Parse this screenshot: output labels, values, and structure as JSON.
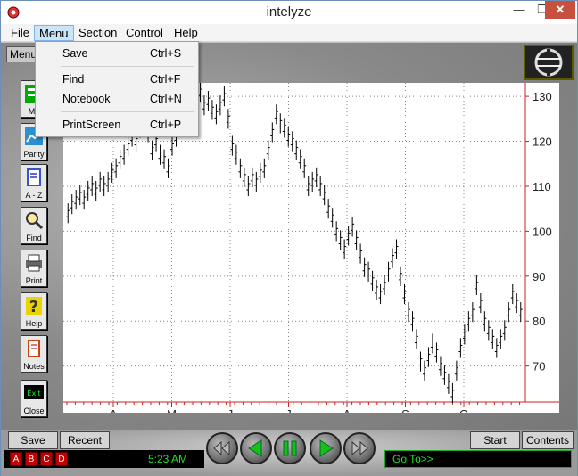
{
  "window": {
    "title": "intelyze"
  },
  "titlebar_buttons": {
    "minimize": "—",
    "maximize": "❐",
    "close": "✕"
  },
  "menubar": [
    {
      "label": "File"
    },
    {
      "label": "Menu"
    },
    {
      "label": "Section"
    },
    {
      "label": "Control"
    },
    {
      "label": "Help"
    }
  ],
  "dropdown": {
    "items": [
      {
        "label": "Save",
        "shortcut": "Ctrl+S"
      },
      {
        "label": "Find",
        "shortcut": "Ctrl+F"
      },
      {
        "label": "Notebook",
        "shortcut": "Ctrl+N"
      },
      {
        "label": "PrintScreen",
        "shortcut": "Ctrl+P"
      }
    ]
  },
  "menu_tab": "Menu",
  "toolbar": [
    {
      "label": "Me",
      "icon": "menu-icon"
    },
    {
      "label": "Parity",
      "icon": "parity-icon"
    },
    {
      "label": "A - Z",
      "icon": "book-icon"
    },
    {
      "label": "Find",
      "icon": "magnifier-icon"
    },
    {
      "label": "Print",
      "icon": "printer-icon"
    },
    {
      "label": "Help",
      "icon": "question-icon"
    },
    {
      "label": "Notes",
      "icon": "notes-icon"
    },
    {
      "label": "Close",
      "icon": "exit-icon",
      "badge": "Exit"
    }
  ],
  "chart_data": {
    "type": "bar",
    "subtype": "ohlc",
    "x_labels": [
      "A",
      "M",
      "J",
      "J",
      "A",
      "S",
      "O"
    ],
    "y_ticks": [
      70,
      80,
      90,
      100,
      110,
      120,
      130
    ],
    "ylim": [
      62,
      133
    ],
    "grid": true,
    "axis_side": "right",
    "series": [
      {
        "values": [
          104,
          106,
          107,
          108,
          107,
          109,
          110,
          109,
          111,
          110,
          111,
          113,
          114,
          116,
          117,
          119,
          121,
          120,
          123,
          124,
          122,
          118,
          120,
          117,
          116,
          114,
          119,
          121,
          125,
          128,
          127,
          126,
          129,
          131,
          128,
          129,
          127,
          126,
          128,
          130,
          125,
          119,
          117,
          114,
          112,
          110,
          112,
          111,
          113,
          114,
          118,
          122,
          126,
          124,
          123,
          121,
          120,
          118,
          116,
          114,
          110,
          111,
          112,
          110,
          108,
          105,
          103,
          100,
          98,
          96,
          99,
          101,
          98,
          95,
          92,
          91,
          89,
          87,
          86,
          88,
          91,
          94,
          96,
          90,
          86,
          82,
          80,
          76,
          71,
          69,
          72,
          75,
          73,
          70,
          68,
          66,
          64,
          69,
          74,
          77,
          80,
          82,
          88,
          84,
          80,
          78,
          76,
          74,
          76,
          78,
          82,
          86,
          84,
          82
        ]
      }
    ]
  },
  "bottombar": {
    "save": "Save",
    "recent": "Recent",
    "start": "Start",
    "contents": "Contents",
    "categories": [
      "A",
      "B",
      "C",
      "D"
    ],
    "clock": "5:23 AM",
    "goto": "Go To>>"
  },
  "colors": {
    "accent_green": "#22e022",
    "category_red": "#c00000",
    "axis_red": "#cc2222"
  }
}
